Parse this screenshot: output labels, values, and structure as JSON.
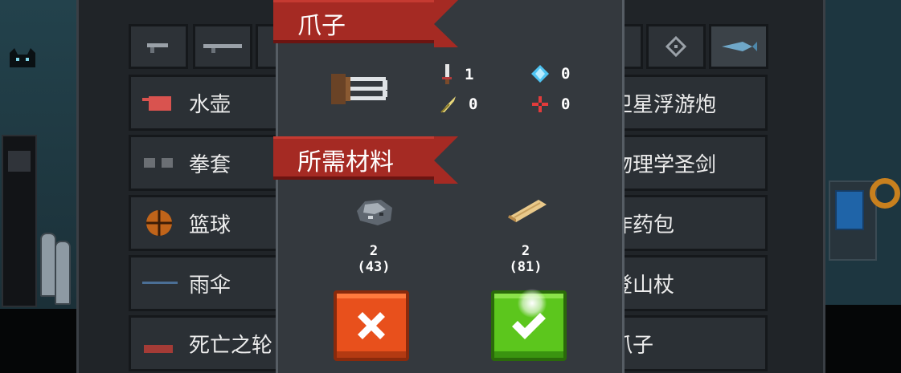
{
  "modal": {
    "title": "爪子",
    "stats": {
      "damage": "1",
      "energy": "0",
      "crit": "0",
      "precision": "0"
    },
    "materials_title": "所需材料",
    "materials": [
      {
        "icon": "ore-icon",
        "required": "2",
        "owned": "(43)"
      },
      {
        "icon": "wood-plank-icon",
        "required": "2",
        "owned": "(81)"
      }
    ],
    "buttons": {
      "cancel": "cancel",
      "confirm": "confirm"
    }
  },
  "list": {
    "tabs": [
      "pistol-tab",
      "rifle-tab",
      "shotgun-tab",
      "laser-tab",
      "target-tab",
      "fish-tab"
    ],
    "left_items": [
      "水壶",
      "拳套",
      "篮球",
      "雨伞",
      "死亡之轮"
    ],
    "right_items": [
      "卫星浮游炮",
      "物理学圣剑",
      "炸药包",
      "登山杖",
      "爪子"
    ]
  },
  "colors": {
    "ribbon": "#a52a23",
    "cancel": "#e8501c",
    "confirm": "#5cc61d",
    "panel": "#34393e"
  }
}
